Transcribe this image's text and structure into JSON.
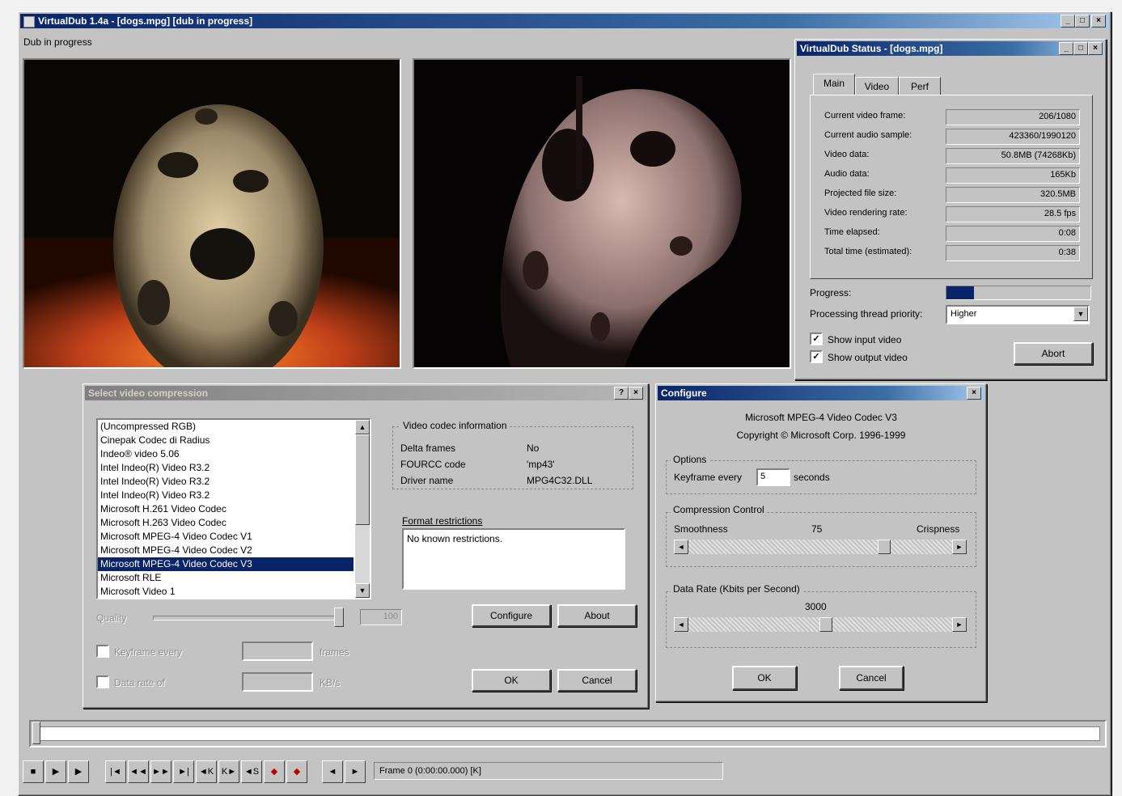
{
  "main_window": {
    "title": "VirtualDub 1.4a - [dogs.mpg] [dub in progress]",
    "status": "Dub in progress"
  },
  "status_window": {
    "title": "VirtualDub Status - [dogs.mpg]",
    "tabs": [
      "Main",
      "Video",
      "Perf"
    ],
    "rows": [
      {
        "label": "Current video frame:",
        "value": "206/1080"
      },
      {
        "label": "Current audio sample:",
        "value": "423360/1990120"
      },
      {
        "label": "Video data:",
        "value": "50.8MB (74268Kb)"
      },
      {
        "label": "Audio data:",
        "value": "165Kb"
      },
      {
        "label": "Projected file size:",
        "value": "320.5MB"
      },
      {
        "label": "Video rendering rate:",
        "value": "28.5 fps"
      },
      {
        "label": "Time elapsed:",
        "value": "0:08"
      },
      {
        "label": "Total time (estimated):",
        "value": "0:38"
      }
    ],
    "progress_label": "Progress:",
    "progress_fraction": 0.19,
    "priority_label": "Processing thread priority:",
    "priority_value": "Higher",
    "show_input_label": "Show input video",
    "show_output_label": "Show output video",
    "abort_label": "Abort"
  },
  "compression_dialog": {
    "title": "Select video compression",
    "codecs": [
      "(Uncompressed RGB)",
      "Cinepak Codec di Radius",
      "Indeo® video 5.06",
      "Intel Indeo(R) Video R3.2",
      "Intel Indeo(R) Video R3.2",
      "Intel Indeo(R) Video R3.2",
      "Microsoft H.261 Video Codec",
      "Microsoft H.263 Video Codec",
      "Microsoft MPEG-4 Video Codec V1",
      "Microsoft MPEG-4 Video Codec V2",
      "Microsoft MPEG-4 Video Codec V3",
      "Microsoft RLE",
      "Microsoft Video 1"
    ],
    "selected_index": 10,
    "info_group": "Video codec information",
    "delta_label": "Delta frames",
    "delta_value": "No",
    "fourcc_label": "FOURCC code",
    "fourcc_value": "'mp43'",
    "driver_label": "Driver name",
    "driver_value": "MPG4C32.DLL",
    "restrictions_group": "Format restrictions",
    "restrictions_text": "No known restrictions.",
    "quality_label": "Quality",
    "quality_value": "100",
    "keyframe_label": "Keyframe every",
    "keyframe_suffix": "frames",
    "datarate_label": "Data rate of",
    "datarate_suffix": "KB/s",
    "configure_label": "Configure",
    "about_label": "About",
    "ok_label": "OK",
    "cancel_label": "Cancel"
  },
  "configure_dialog": {
    "title": "Configure",
    "codec_name": "Microsoft MPEG-4 Video Codec V3",
    "copyright": "Copyright © Microsoft Corp. 1996-1999",
    "options_group": "Options",
    "keyframe_label": "Keyframe every",
    "keyframe_value": "5",
    "keyframe_unit": "seconds",
    "compression_group": "Compression Control",
    "smoothness_label": "Smoothness",
    "smoothness_value": "75",
    "crispness_label": "Crispness",
    "smoothness_level": 0.75,
    "datarate_group": "Data Rate (Kbits per Second)",
    "datarate_value": "3000",
    "datarate_level": 0.52,
    "ok_label": "OK",
    "cancel_label": "Cancel"
  },
  "toolbar": {
    "frame_readout": "Frame 0 (0:00:00.000) [K]"
  }
}
